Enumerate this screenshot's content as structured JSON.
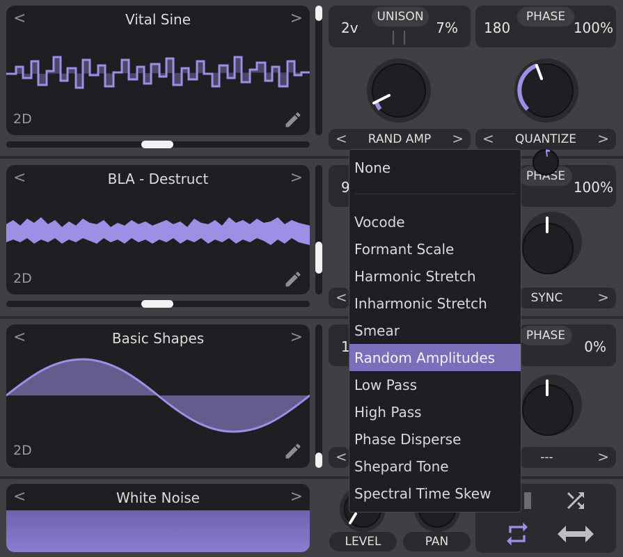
{
  "oscillators": [
    {
      "wavetable": "Vital Sine",
      "dimension": "2D",
      "unison_voices": "2v",
      "unison_label": "UNISON",
      "unison_detune": "7%",
      "phase_value": "180",
      "phase_label": "PHASE",
      "phase_random": "100%",
      "spectral_mode": "RAND AMP",
      "random_mode": "QUANTIZE"
    },
    {
      "wavetable": "BLA - Destruct",
      "dimension": "2D",
      "unison_voices": "9",
      "phase_label": "PHASE",
      "phase_random": "100%",
      "random_mode": "SYNC"
    },
    {
      "wavetable": "Basic Shapes",
      "dimension": "2D",
      "unison_voices": "1",
      "phase_label": "PHASE",
      "phase_random": "0%",
      "random_mode": "---"
    }
  ],
  "noise": {
    "name": "White Noise",
    "level_label": "LEVEL",
    "pan_label": "PAN"
  },
  "nav": {
    "left_arrow": "<",
    "right_arrow": ">"
  },
  "dropdown": {
    "items": [
      "None",
      "Vocode",
      "Formant Scale",
      "Harmonic Stretch",
      "Inharmonic Stretch",
      "Smear",
      "Random Amplitudes",
      "Low Pass",
      "High Pass",
      "Phase Disperse",
      "Shepard Tone",
      "Spectral Time Skew"
    ],
    "selected": "Random Amplitudes"
  },
  "icons": [
    "pencil-icon",
    "shuffle-icon",
    "loop-icon",
    "swap-arrows-icon",
    "bars-icon"
  ],
  "colors": {
    "accent": "#9d8ee6",
    "background": "#3c3d41",
    "display": "#1e1f22"
  }
}
